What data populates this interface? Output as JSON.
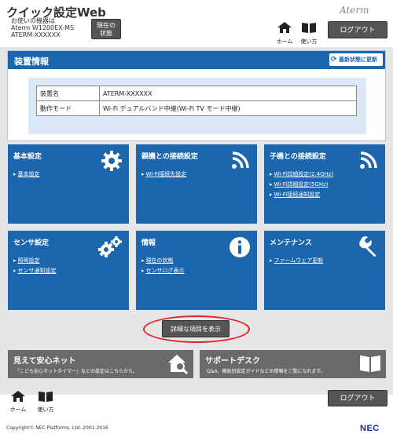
{
  "header": {
    "app_title": "クイック設定Web",
    "device_line1": "お使いの機器は",
    "device_line2": "Aterm W1200EX-MS",
    "device_line3": "ATERM-XXXXXX",
    "status_button_line1": "現在の",
    "status_button_line2": "状態",
    "brand": "Aterm",
    "home_label": "ホーム",
    "usage_label": "使い方",
    "logout_label": "ログアウト"
  },
  "device_panel": {
    "title": "装置情報",
    "refresh_label": "最新状態に更新",
    "rows": [
      {
        "key": "装置名",
        "value": "ATERM-XXXXXX"
      },
      {
        "key": "動作モード",
        "value": "Wi-Fi デュアルバンド中継(Wi-Fi TV モード中継)"
      }
    ]
  },
  "tiles": [
    {
      "title": "基本設定",
      "icon": "gear-icon",
      "links": [
        "基本設定"
      ]
    },
    {
      "title": "親機との接続設定",
      "icon": "wifi-icon",
      "links": [
        "Wi-Fi接続先設定"
      ]
    },
    {
      "title": "子機との接続設定",
      "icon": "wifi-icon",
      "links": [
        "Wi-Fi詳細設定(2.4GHz)",
        "Wi-Fi詳細設定(5GHz)",
        "Wi-Fi接続通知設定"
      ]
    },
    {
      "title": "センサ設定",
      "icon": "gears-icon",
      "links": [
        "照明設定",
        "センサ通知設定"
      ]
    },
    {
      "title": "情報",
      "icon": "info-icon",
      "links": [
        "現在の状態",
        "センサログ表示"
      ]
    },
    {
      "title": "メンテナンス",
      "icon": "wrench-icon",
      "links": [
        "ファームウェア更新"
      ]
    }
  ],
  "detail_button_label": "詳細な項目を表示",
  "bottom_cards": [
    {
      "title": "見えて安心ネット",
      "desc": "「こども安心ネットタイマー」などの設定はこちらから。",
      "icon": "house-search-icon"
    },
    {
      "title": "サポートデスク",
      "desc": "Q&A、機能別設定ガイドなどの情報をご覧になれます。",
      "icon": "book-icon"
    }
  ],
  "footer": {
    "home_label": "ホーム",
    "usage_label": "使い方",
    "logout_label": "ログアウト",
    "copyright": "Copyright© NEC Platforms, Ltd. 2001-2016",
    "company_logo": "NEC"
  },
  "colors": {
    "primary_blue": "#1c66ae",
    "button_gray": "#555555",
    "card_gray": "#6a6a6a",
    "highlight_red": "#e8202a",
    "info_bg": "#dbe9f7"
  }
}
